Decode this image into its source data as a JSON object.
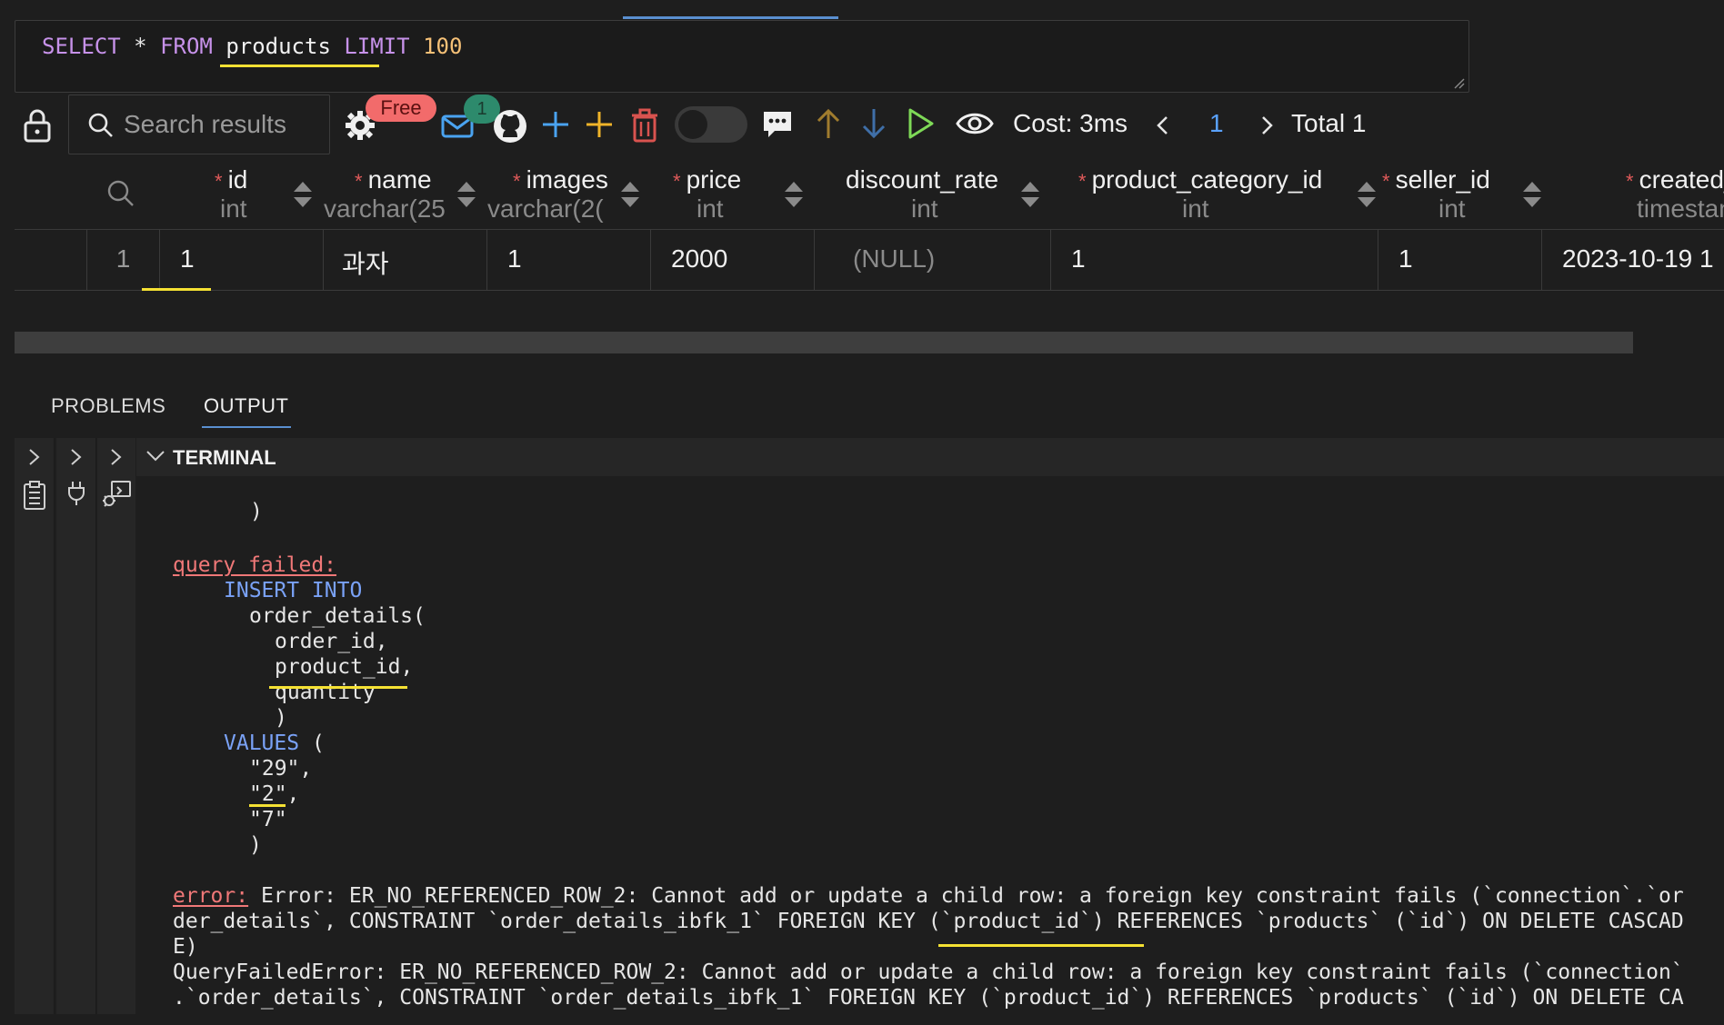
{
  "editor": {
    "kw_select": "SELECT",
    "op_star": "*",
    "kw_from": "FROM",
    "table": "products",
    "kw_limit": "LIMIT",
    "limit": "100"
  },
  "toolbar": {
    "search_placeholder": "Search results",
    "free_badge": "Free",
    "count_badge": "1",
    "cost": "Cost: 3ms",
    "page": "1",
    "total": "Total 1",
    "icons": [
      "lock-icon",
      "search-icon",
      "gear-icon",
      "mail-icon",
      "github-icon",
      "add-row-icon",
      "add-icon",
      "delete-icon",
      "toggle",
      "comment-icon",
      "arrow-up-icon",
      "arrow-down-icon",
      "run-icon",
      "eye-icon",
      "chevron-left-icon",
      "chevron-right-icon"
    ]
  },
  "table": {
    "columns": [
      {
        "name": "id",
        "type": "int",
        "required": "*"
      },
      {
        "name": "name",
        "type": "varchar(25",
        "required": "*"
      },
      {
        "name": "images",
        "type": "varchar(2(",
        "required": "*"
      },
      {
        "name": "price",
        "type": "int",
        "required": "*"
      },
      {
        "name": "discount_rate",
        "type": "int",
        "required": ""
      },
      {
        "name": "product_category_id",
        "type": "int",
        "required": "*"
      },
      {
        "name": "seller_id",
        "type": "int",
        "required": "*"
      },
      {
        "name": "created_",
        "type": "timestam",
        "required": "*"
      }
    ],
    "row": {
      "rownum": "1",
      "cells": [
        "1",
        "과자",
        "1",
        "2000",
        "(NULL)",
        "1",
        "1",
        "2023-10-19 1"
      ]
    }
  },
  "panel": {
    "tab_problems": "PROBLEMS",
    "tab_output": "OUTPUT",
    "terminal_title": "TERMINAL"
  },
  "terminal": {
    "l1": ")",
    "l2": "query failed:",
    "l3": "INSERT INTO",
    "l4": "order_details(",
    "l5": "order_id,",
    "l6": "product_id,",
    "l7": "quantity",
    "l8": ")",
    "l9_kw": "VALUES",
    "l9_rest": " (",
    "l10": "\"29\",",
    "l11": "\"2\",",
    "l12": "\"7\"",
    "l13": ")",
    "err_label": "error:",
    "err_1": " Error: ER_NO_REFERENCED_ROW_2: Cannot add or update a child row: a foreign key constraint fails (`connection`.`or",
    "err_2": "der_details`, CONSTRAINT `order_details_ibfk_1` FOREIGN KEY (`product_id`) REFERENCES `products` (`id`) ON DELETE CASCAD",
    "err_3": "E)",
    "qf_1": "QueryFailedError: ER_NO_REFERENCED_ROW_2: Cannot add or update a child row: a foreign key constraint fails (`connection`",
    "qf_2": ".`order_details`, CONSTRAINT `order_details_ibfk_1` FOREIGN KEY (`product_id`) REFERENCES `products` (`id`) ON DELETE CA"
  },
  "colors": {
    "keyword": "#c792ea",
    "number": "#f6c177",
    "error": "#f07878",
    "sql_keyword_term": "#7aa2f7",
    "annotation": "#f5e133",
    "badge_free": "#f26b6b",
    "badge_count": "#2d8a6c",
    "link": "#5aa2ff"
  }
}
